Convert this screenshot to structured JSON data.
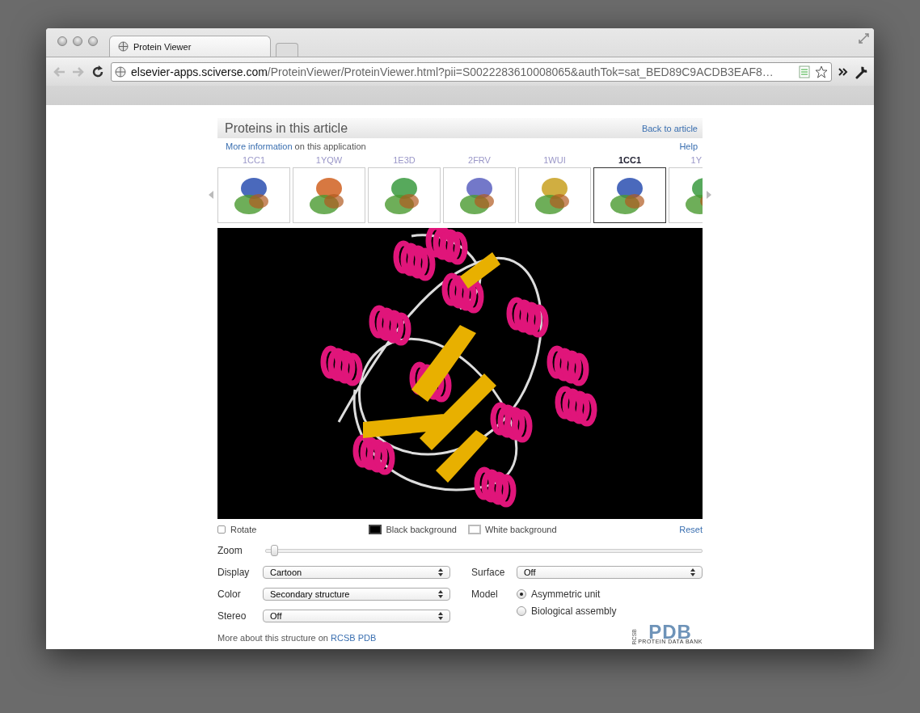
{
  "window": {
    "tab_title": "Protein Viewer",
    "url_host": "elsevier-apps.sciverse.com",
    "url_path": "/ProteinViewer/ProteinViewer.html?pii=S0022283610008065&authTok=sat_BED89C9ACDB3EAF8…"
  },
  "header": {
    "title": "Proteins in this article",
    "back_link": "Back to article"
  },
  "info": {
    "link": "More information",
    "text": "on this application",
    "help": "Help"
  },
  "thumbnails": [
    {
      "label": "1CC1",
      "selected": false
    },
    {
      "label": "1YQW",
      "selected": false
    },
    {
      "label": "1E3D",
      "selected": false
    },
    {
      "label": "2FRV",
      "selected": false
    },
    {
      "label": "1WUI",
      "selected": false
    },
    {
      "label": "1CC1",
      "selected": true
    },
    {
      "label": "1Y",
      "selected": false
    }
  ],
  "options": {
    "rotate": {
      "label": "Rotate",
      "checked": false
    },
    "backgrounds": [
      {
        "label": "Black background",
        "color": "#000000",
        "selected": true
      },
      {
        "label": "White background",
        "color": "#ffffff",
        "selected": false
      }
    ],
    "reset": "Reset"
  },
  "zoom": {
    "label": "Zoom",
    "level": 0.02
  },
  "settings": [
    {
      "label": "Display",
      "value": "Cartoon"
    },
    {
      "label": "Color",
      "value": "Secondary structure"
    },
    {
      "label": "Stereo",
      "value": "Off"
    }
  ],
  "surface": {
    "label": "Surface",
    "value": "Off"
  },
  "model": {
    "label": "Model",
    "options": [
      {
        "label": "Asymmetric unit",
        "selected": true
      },
      {
        "label": "Biological assembly",
        "selected": false
      }
    ]
  },
  "footer": {
    "text": "More about this structure on",
    "link": "RCSB PDB"
  },
  "logo": {
    "side": "RCSB",
    "main": "PDB",
    "sub": "PROTEIN DATA BANK"
  }
}
